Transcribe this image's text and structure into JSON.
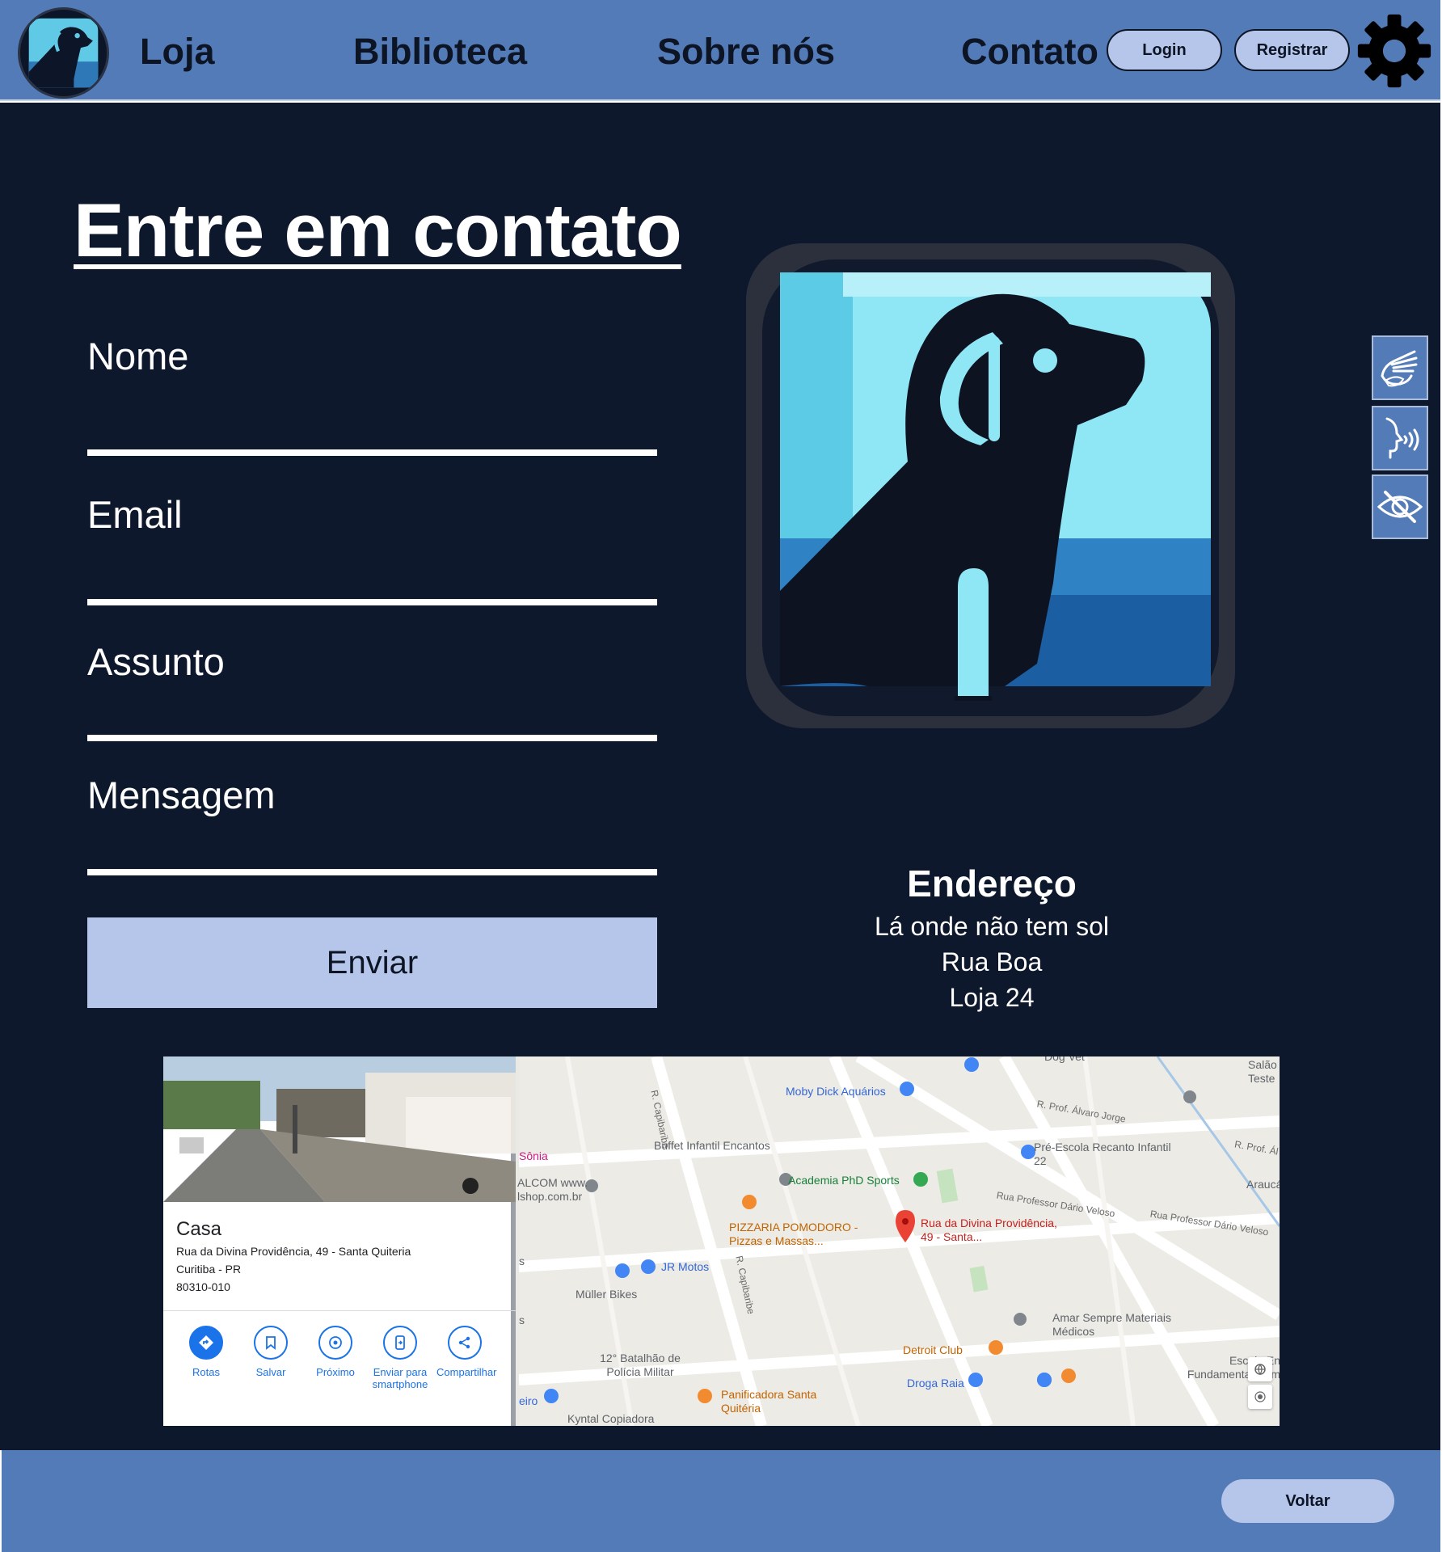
{
  "header": {
    "nav": [
      "Loja",
      "Biblioteca",
      "Sobre nós",
      "Contato"
    ],
    "login_label": "Login",
    "register_label": "Registrar",
    "settings_icon": "gear-icon",
    "logo_icon": "dog-logo-icon"
  },
  "contact": {
    "title": "Entre em contato",
    "fields": {
      "name": "Nome",
      "email": "Email",
      "subject": "Assunto",
      "message": "Mensagem"
    },
    "send_label": "Enviar"
  },
  "address": {
    "title": "Endereço",
    "lines": [
      "Lá onde não tem sol",
      "Rua Boa",
      "Loja 24"
    ]
  },
  "accessibility": {
    "icons": [
      "sign-language-icon",
      "speech-icon",
      "hide-eye-icon"
    ]
  },
  "map": {
    "card": {
      "title": "Casa",
      "address_line1": "Rua da Divina Providência, 49 - Santa Quiteria",
      "address_line2": "Curitiba - PR",
      "postcode": "80310-010",
      "actions": [
        "Rotas",
        "Salvar",
        "Próximo",
        "Enviar para smartphone",
        "Compartilhar"
      ]
    },
    "labels": {
      "moby_dick": "Moby Dick Aquários",
      "dog_vet": "Dog Vet",
      "salao": "Salão Teste",
      "r_capibaribe_1": "R. Capibaribe",
      "r_prof_alvaro": "R. Prof. Álvaro Jorge",
      "r_prof_a": "R. Prof. Ál",
      "buffet": "Buffet Infantil Encantos",
      "pre_escola": "Pré-Escola Recanto Infantil 22",
      "sonia": "Sônia",
      "alcom": "ALCOM www. lshop.com.br",
      "academia": "Academia PhD Sports",
      "arauca": "Araucá",
      "rua_prof_dario_1": "Rua Professor Dário Veloso",
      "rua_prof_dario_2": "Rua Professor Dário Veloso",
      "pizzaria": "PIZZARIA POMODORO - Pizzas e Massas...",
      "pin_address": "Rua da Divina Providência, 49 - Santa...",
      "jr_motos": "JR Motos",
      "r_capibaribe_2": "R. Capibaribe",
      "muller": "Müller Bikes",
      "amar_sempre": "Amar Sempre Materiais Médicos",
      "batalhao": "12° Batalhão de Polícia Militar",
      "detroit": "Detroit Club",
      "escola": "Escola En Fundamental Cam",
      "droga_raia": "Droga Raia",
      "panificadora": "Panificadora Santa Quitéria",
      "kyntal": "Kyntal Copiadora",
      "eiro": "eiro",
      "s_1": "s",
      "s_2": "s"
    }
  },
  "footer": {
    "back_label": "Voltar"
  },
  "colors": {
    "header_bg": "#537bb7",
    "main_bg": "#0d182c",
    "button_bg": "#b5c6ea",
    "text_dark": "#0d1424"
  }
}
